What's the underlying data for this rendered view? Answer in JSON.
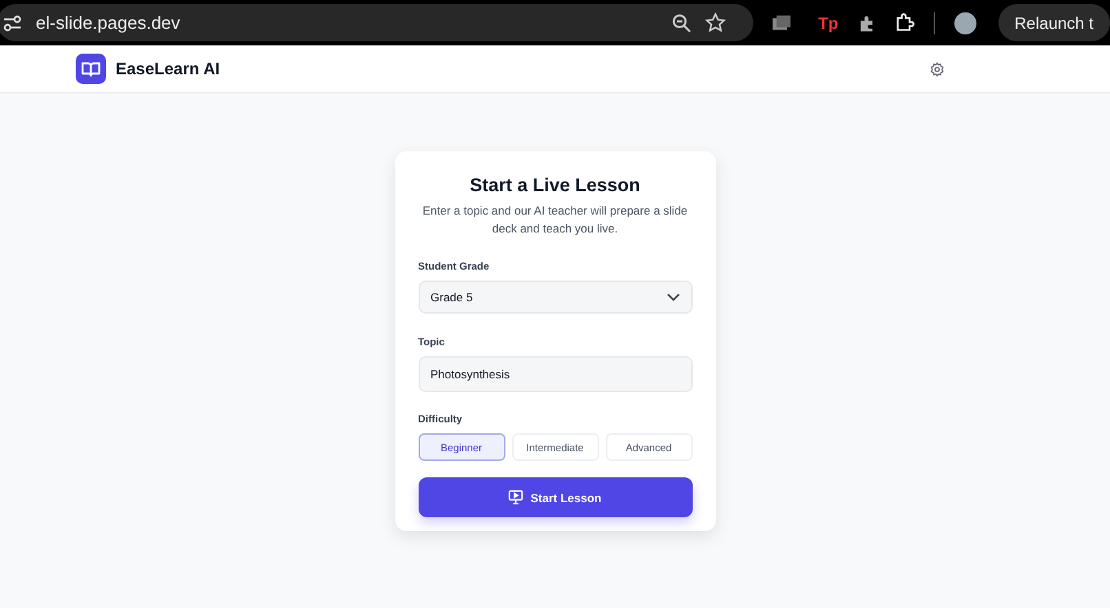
{
  "browser": {
    "url": "el-slide.pages.dev",
    "relaunch_button": "Relaunch t",
    "toolbar_badge": "Tp"
  },
  "header": {
    "brand": "EaseLearn AI"
  },
  "card": {
    "title": "Start a Live Lesson",
    "subtitle": "Enter a topic and our AI teacher will prepare a slide deck and teach you live.",
    "grade": {
      "label": "Student Grade",
      "value": "Grade 5"
    },
    "topic": {
      "label": "Topic",
      "value": "Photosynthesis"
    },
    "difficulty": {
      "label": "Difficulty",
      "options": [
        {
          "label": "Beginner",
          "selected": true
        },
        {
          "label": "Intermediate",
          "selected": false
        },
        {
          "label": "Advanced",
          "selected": false
        }
      ]
    },
    "submit": "Start Lesson"
  }
}
